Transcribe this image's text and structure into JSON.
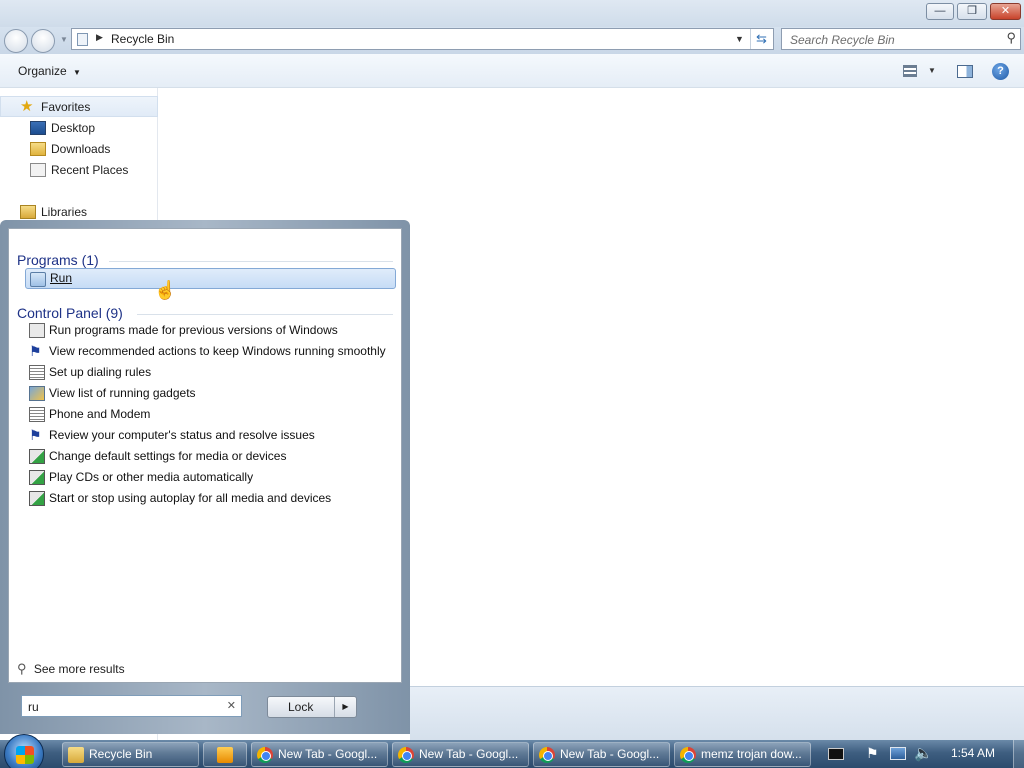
{
  "window": {
    "caption_buttons": {
      "minimize": "—",
      "restore": "❐",
      "close": "✕"
    }
  },
  "address_bar": {
    "location": "Recycle Bin",
    "search_placeholder": "Search Recycle Bin"
  },
  "command_bar": {
    "organize_label": "Organize"
  },
  "nav_pane": {
    "favorites_label": "Favorites",
    "items": [
      {
        "label": "Desktop",
        "icon": "desktop-icon"
      },
      {
        "label": "Downloads",
        "icon": "folder-icon"
      },
      {
        "label": "Recent Places",
        "icon": "recent-places-icon"
      }
    ],
    "libraries_label": "Libraries"
  },
  "start_menu": {
    "programs_header": "Programs (1)",
    "programs": [
      {
        "label": "Run",
        "icon": "run-icon",
        "selected": true
      }
    ],
    "control_panel_header": "Control Panel (9)",
    "control_panel": [
      {
        "label": "Run programs made for previous versions of Windows",
        "icon": "compat-icon"
      },
      {
        "label": "View recommended actions to keep Windows running smoothly",
        "icon": "flag-icon"
      },
      {
        "label": "Set up dialing rules",
        "icon": "phone-icon"
      },
      {
        "label": "View list of running gadgets",
        "icon": "gadgets-icon"
      },
      {
        "label": "Phone and Modem",
        "icon": "phone-icon"
      },
      {
        "label": "Review your computer's status and resolve issues",
        "icon": "flag-icon"
      },
      {
        "label": "Change default settings for media or devices",
        "icon": "autoplay-icon"
      },
      {
        "label": "Play CDs or other media automatically",
        "icon": "autoplay-icon"
      },
      {
        "label": "Start or stop using autoplay for all media and devices",
        "icon": "autoplay-icon"
      }
    ],
    "see_more": "See more results",
    "search_value": "ru",
    "lock_label": "Lock"
  },
  "taskbar": {
    "items": [
      {
        "label": "Recycle Bin",
        "icon": "folder-icon"
      },
      {
        "label": "",
        "icon": "media-player-icon"
      },
      {
        "label": "New Tab - Googl...",
        "icon": "chrome-icon"
      },
      {
        "label": "New Tab - Googl...",
        "icon": "chrome-icon"
      },
      {
        "label": "New Tab - Googl...",
        "icon": "chrome-icon"
      },
      {
        "label": "memz trojan dow...",
        "icon": "chrome-icon"
      }
    ],
    "clock": "1:54 AM"
  }
}
